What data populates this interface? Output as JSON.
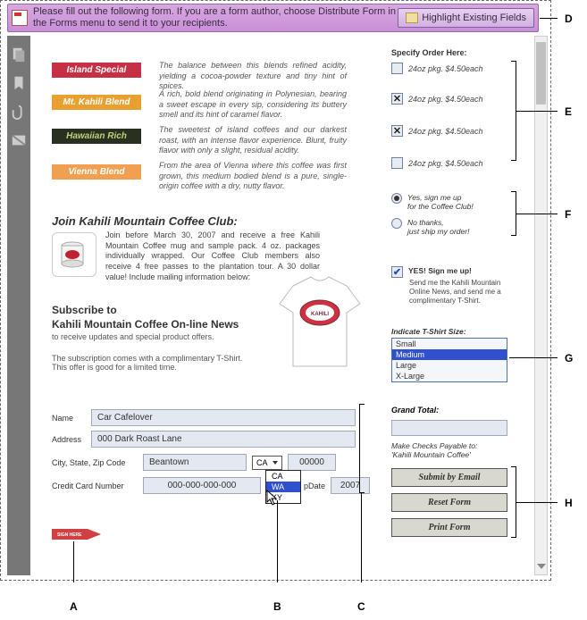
{
  "header": {
    "msg": "Please fill out the following form. If you are a form author, choose Distribute Form in the Forms menu to send it to your recipients.",
    "highlight": "Highlight Existing Fields"
  },
  "specify_head": "Specify Order Here:",
  "coffees": [
    {
      "name": "Island Special",
      "desc": "The balance between this blends refined acidity, yielding a cocoa-powder texture and tiny hint of spices.",
      "price": "24oz pkg. $4.50each",
      "checked": false
    },
    {
      "name": "Mt. Kahili  Blend",
      "desc": "A rich, bold blend originating in Polynesian, bearing a sweet escape in every sip, considering its buttery smell and its hint of caramel flavor.",
      "price": "24oz pkg. $4.50each",
      "checked": true
    },
    {
      "name": "Hawaiian Rich",
      "desc": "The sweetest of island coffees and our darkest roast, with an intense flavor experience. Blunt, fruity flavor with only a slight, residual acidity.",
      "price": "24oz pkg. $4.50each",
      "checked": true
    },
    {
      "name": "Vienna Blend",
      "desc": "From the area of Vienna where this coffee was first grown, this medium bodied blend is a pure, single- origin coffee with a dry, nutty flavor.",
      "price": "24oz pkg. $4.50each",
      "checked": false
    }
  ],
  "radios": [
    {
      "label1": "Yes, sign me up",
      "label2": "for the Coffee Club!",
      "sel": true
    },
    {
      "label1": "No thanks,",
      "label2": "just ship my order!",
      "sel": false
    }
  ],
  "join": {
    "head": "Join Kahili Mountain Coffee Club:",
    "desc": "Join before March 30, 2007 and receive a free Kahili Mountain Coffee mug and sample pack. 4 oz. packages individually wrapped. Our Coffee Club members also receive 4 free passes to the plantation tour. A 30 dollar value! Include mailing information below:"
  },
  "subscribe": {
    "l1": "Subscribe to",
    "l2": "Kahili Mountain Coffee On-line News",
    "sub": "to receive updates and special product offers.",
    "note1": "The subscription comes with a complimentary T-Shirt.",
    "note2": "This offer is good for a limited time."
  },
  "yes": {
    "head": "YES! Sign me up!",
    "body": "Send me the Kahili Mountain Online News, and send me a complimentary T-Shirt."
  },
  "tshirt_head": "Indicate T-Shirt Size:",
  "sizes": [
    "Small",
    "Medium",
    "Large",
    "X-Large"
  ],
  "size_selected": 1,
  "form": {
    "name_label": "Name",
    "name_value": "Car Cafelover",
    "addr_label": "Address",
    "addr_value": "000 Dark Roast Lane",
    "csz_label": "City, State, Zip Code",
    "city": "Beantown",
    "state": "CA",
    "zip": "00000",
    "cc_label": "Credit Card Number",
    "cc_value": "000-000-000-000",
    "exp_label": "pDate",
    "exp_value": "2007"
  },
  "states": [
    "CA",
    "WA",
    "KY"
  ],
  "state_hl": 1,
  "total_head": "Grand Total:",
  "payable1": "Make Checks Payable to:",
  "payable2": "'Kahili Mountain Coffee'",
  "buttons": {
    "submit": "Submit by Email",
    "reset": "Reset Form",
    "print": "Print Form"
  },
  "callouts": {
    "A": "A",
    "B": "B",
    "C": "C",
    "D": "D",
    "E": "E",
    "F": "F",
    "G": "G",
    "H": "H"
  }
}
